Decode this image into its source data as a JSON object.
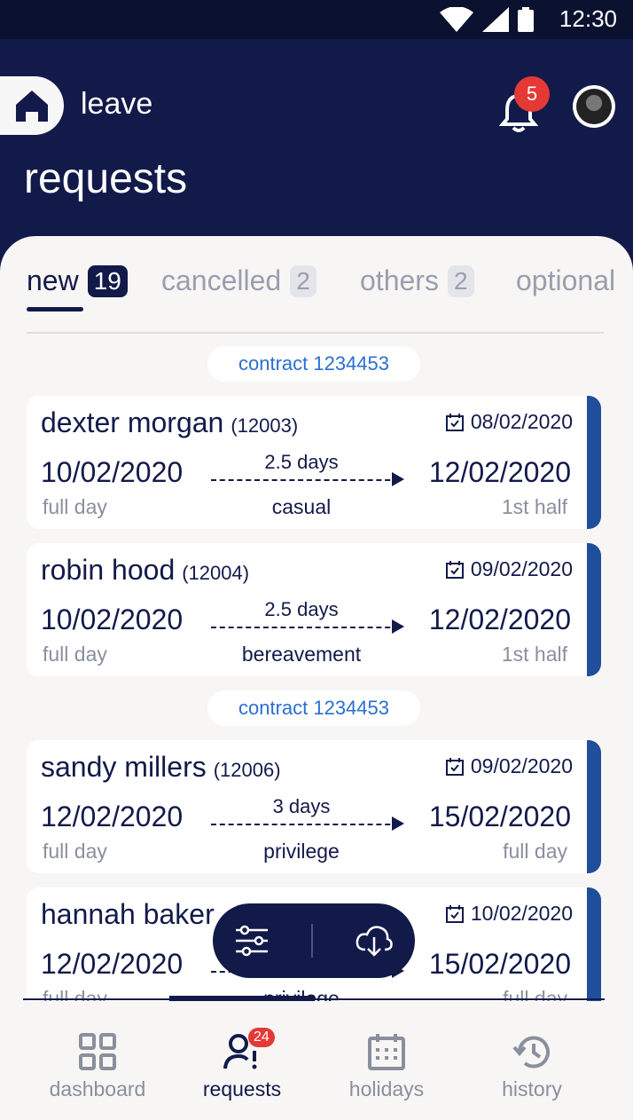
{
  "status": {
    "time": "12:30"
  },
  "header": {
    "module": "leave",
    "title": "requests",
    "notifications": "5"
  },
  "tabs": [
    {
      "label": "new",
      "count": "19"
    },
    {
      "label": "cancelled",
      "count": "2"
    },
    {
      "label": "others",
      "count": "2"
    },
    {
      "label": "optional",
      "count": ""
    }
  ],
  "groups": [
    {
      "contract": "contract 1234453"
    },
    {
      "contract": "contract 1234453"
    }
  ],
  "requests": [
    {
      "name": "dexter morgan",
      "emp_id": "(12003)",
      "applied": "08/02/2020",
      "from": "10/02/2020",
      "from_sub": "full day",
      "to": "12/02/2020",
      "to_sub": "1st half",
      "days": "2.5 days",
      "type": "casual"
    },
    {
      "name": "robin hood",
      "emp_id": "(12004)",
      "applied": "09/02/2020",
      "from": "10/02/2020",
      "from_sub": "full day",
      "to": "12/02/2020",
      "to_sub": "1st half",
      "days": "2.5 days",
      "type": "bereavement"
    },
    {
      "name": "sandy millers",
      "emp_id": "(12006)",
      "applied": "09/02/2020",
      "from": "12/02/2020",
      "from_sub": "full day",
      "to": "15/02/2020",
      "to_sub": "full day",
      "days": "3 days",
      "type": "privilege"
    },
    {
      "name": "hannah baker",
      "emp_id": "",
      "applied": "10/02/2020",
      "from": "12/02/2020",
      "from_sub": "full day",
      "to": "15/02/2020",
      "to_sub": "full day",
      "days": "",
      "type": "privilege"
    }
  ],
  "nav": [
    {
      "label": "dashboard"
    },
    {
      "label": "requests",
      "badge": "24"
    },
    {
      "label": "holidays"
    },
    {
      "label": "history"
    }
  ],
  "colors": {
    "navy": "#121a4a",
    "accent": "#1f4f9b",
    "link": "#2b6fcf",
    "badge": "#e53935"
  }
}
